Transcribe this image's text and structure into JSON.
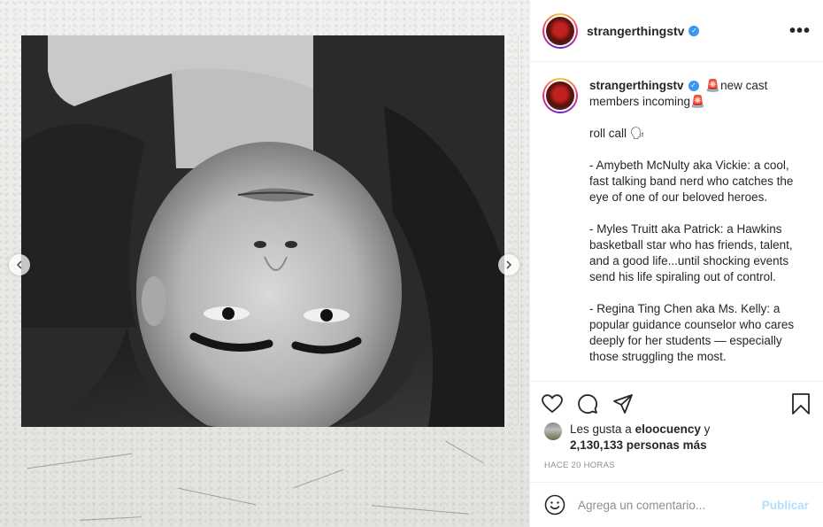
{
  "post": {
    "username": "strangerthingstv",
    "avatar_text": "STRANGER THINGS",
    "verified_mark": "✓",
    "more_icon": "•••"
  },
  "caption": {
    "username": "strangerthingstv",
    "paragraphs": [
      "🚨new cast members incoming🚨",
      "roll call 🗣",
      "- Amybeth McNulty aka Vickie: a cool, fast talking band nerd who catches the eye of one of our beloved heroes.",
      "- Myles Truitt aka Patrick: a Hawkins basketball star who has friends, talent, and a good life...until shocking events send his life spiraling out of control.",
      "- Regina Ting Chen aka Ms. Kelly: a popular guidance counselor who cares deeply for her students — especially those struggling the most."
    ]
  },
  "likes": {
    "prefix": "Les gusta a ",
    "user": "eloocuency",
    "joiner": " y",
    "count": "2,130,133 personas más"
  },
  "timestamp": "HACE 20 HORAS",
  "comment": {
    "placeholder": "Agrega un comentario...",
    "publish_label": "Publicar"
  },
  "colors": {
    "verified": "#3897f0",
    "publish_disabled": "#b2dffc",
    "muted_text": "#8e8e8e"
  },
  "icons": [
    "heart-icon",
    "comment-icon",
    "share-icon",
    "bookmark-icon",
    "emoji-icon",
    "chevron-left-icon",
    "chevron-right-icon",
    "more-options-icon",
    "verified-badge-icon"
  ]
}
